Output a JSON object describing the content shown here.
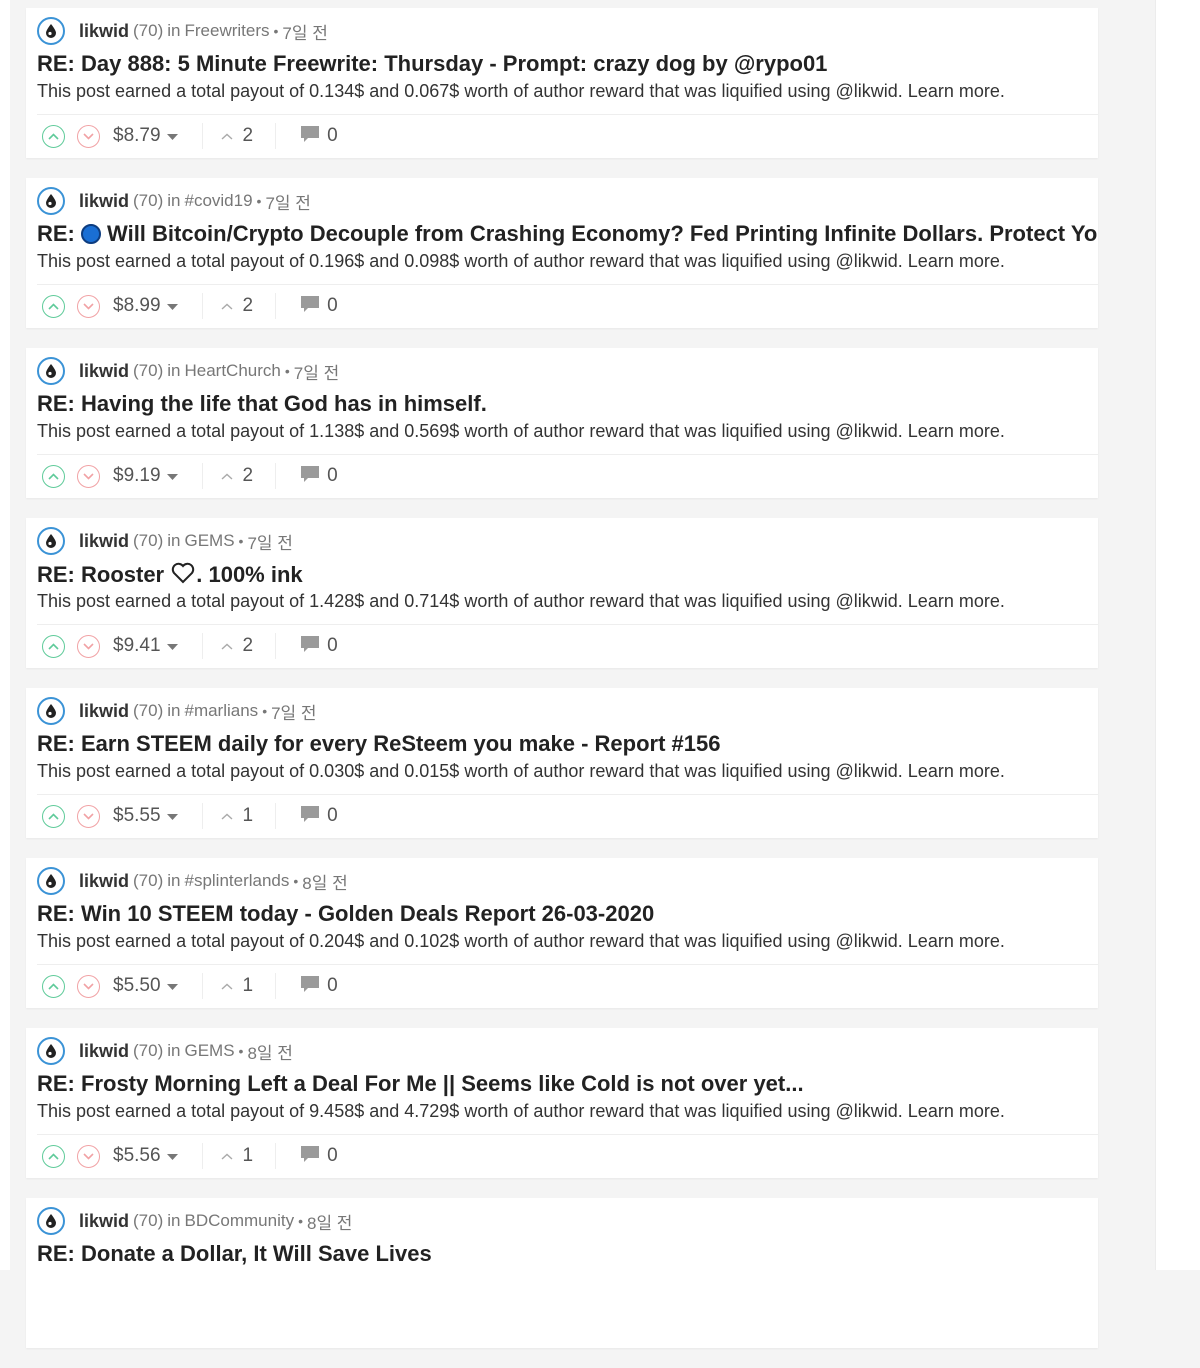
{
  "posts": [
    {
      "author": "likwid",
      "reputation": "(70)",
      "in_word": "in",
      "community": "Freewriters",
      "time": "7일 전",
      "title": "RE: Day 888: 5 Minute Freewrite: Thursday - Prompt: crazy dog by @rypo01",
      "summary": "This post earned a total payout of 0.134$ and 0.067$ worth of author reward that was liquified using @likwid. Learn more.",
      "payout": "$8.79",
      "votes": "2",
      "comments": "0"
    },
    {
      "author": "likwid",
      "reputation": "(70)",
      "in_word": "in",
      "community": "#covid19",
      "time": "7일 전",
      "title_prefix": "RE:",
      "title": "Will Bitcoin/Crypto Decouple from Crashing Economy? Fed Printing Infinite Dollars. Protect Yourse",
      "summary": "This post earned a total payout of 0.196$ and 0.098$ worth of author reward that was liquified using @likwid. Learn more.",
      "payout": "$8.99",
      "votes": "2",
      "comments": "0"
    },
    {
      "author": "likwid",
      "reputation": "(70)",
      "in_word": "in",
      "community": "HeartChurch",
      "time": "7일 전",
      "title": "RE: Having the life that God has in himself.",
      "summary": "This post earned a total payout of 1.138$ and 0.569$ worth of author reward that was liquified using @likwid. Learn more.",
      "payout": "$9.19",
      "votes": "2",
      "comments": "0"
    },
    {
      "author": "likwid",
      "reputation": "(70)",
      "in_word": "in",
      "community": "GEMS",
      "time": "7일 전",
      "title_prefix": "RE: Rooster",
      "title_suffix": ". 100% ink",
      "summary": "This post earned a total payout of 1.428$ and 0.714$ worth of author reward that was liquified using @likwid. Learn more.",
      "payout": "$9.41",
      "votes": "2",
      "comments": "0"
    },
    {
      "author": "likwid",
      "reputation": "(70)",
      "in_word": "in",
      "community": "#marlians",
      "time": "7일 전",
      "title": "RE: Earn STEEM daily for every ReSteem you make - Report #156",
      "summary": "This post earned a total payout of 0.030$ and 0.015$ worth of author reward that was liquified using @likwid. Learn more.",
      "payout": "$5.55",
      "votes": "1",
      "comments": "0"
    },
    {
      "author": "likwid",
      "reputation": "(70)",
      "in_word": "in",
      "community": "#splinterlands",
      "time": "8일 전",
      "title": "RE: Win 10 STEEM today - Golden Deals Report 26-03-2020",
      "summary": "This post earned a total payout of 0.204$ and 0.102$ worth of author reward that was liquified using @likwid. Learn more.",
      "payout": "$5.50",
      "votes": "1",
      "comments": "0"
    },
    {
      "author": "likwid",
      "reputation": "(70)",
      "in_word": "in",
      "community": "GEMS",
      "time": "8일 전",
      "title": "RE: Frosty Morning Left a Deal For Me || Seems like Cold is not over yet...",
      "summary": "This post earned a total payout of 9.458$ and 4.729$ worth of author reward that was liquified using @likwid. Learn more.",
      "payout": "$5.56",
      "votes": "1",
      "comments": "0"
    },
    {
      "author": "likwid",
      "reputation": "(70)",
      "in_word": "in",
      "community": "BDCommunity",
      "time": "8일 전",
      "title": "RE: Donate a Dollar, It Will Save Lives"
    }
  ],
  "separator": "•",
  "icons": {
    "avatar": "drop-logo-icon",
    "upvote": "chevron-up-circle-icon",
    "downvote": "chevron-down-circle-icon",
    "payout_dropdown": "caret-down-icon",
    "voters": "chevron-up-icon",
    "comments": "comment-bubble-icon",
    "title_badge": "blue-circle-icon",
    "title_emoji": "heart-icon"
  },
  "colors": {
    "upvote": "#5fcb9a",
    "downvote": "#f1a2a5",
    "avatar_ring": "#3b93d6",
    "blue_badge": "#1a6fd4"
  }
}
